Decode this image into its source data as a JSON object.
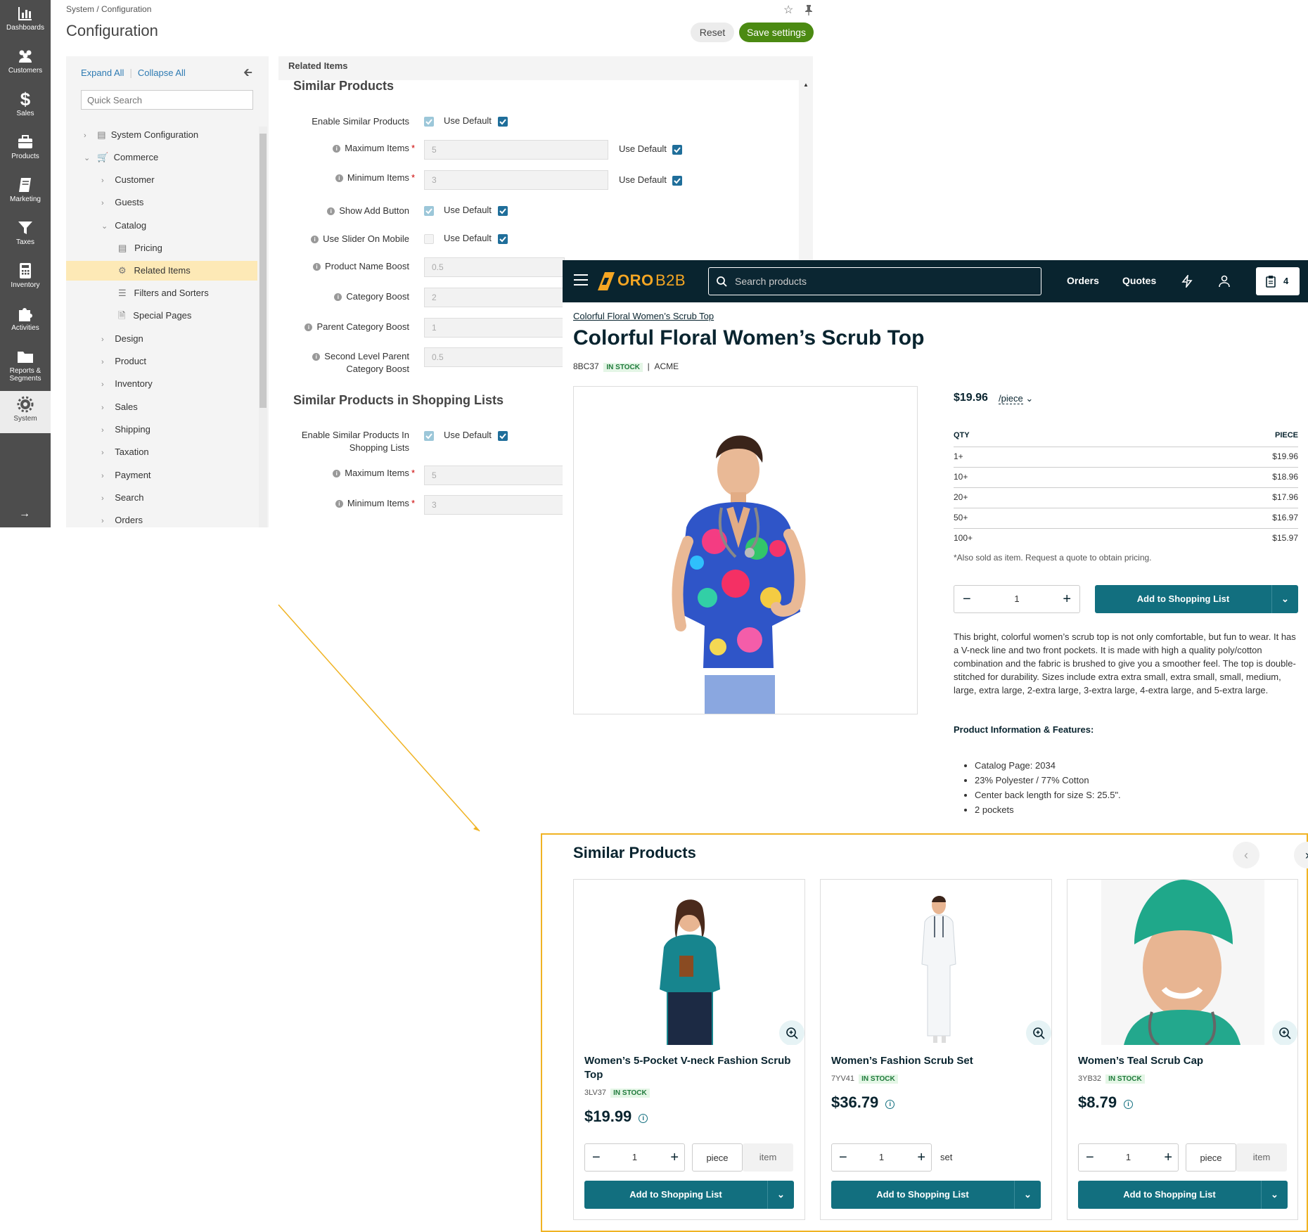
{
  "nav": [
    {
      "label": "Dashboards",
      "icon": "bar-chart-icon"
    },
    {
      "label": "Customers",
      "icon": "users-icon"
    },
    {
      "label": "Sales",
      "icon": "dollar-icon"
    },
    {
      "label": "Products",
      "icon": "briefcase-icon"
    },
    {
      "label": "Marketing",
      "icon": "book-icon"
    },
    {
      "label": "Taxes",
      "icon": "filter-icon"
    },
    {
      "label": "Inventory",
      "icon": "calculator-icon"
    },
    {
      "label": "Activities",
      "icon": "puzzle-icon"
    },
    {
      "label": "Reports & Segments",
      "icon": "folder-icon"
    },
    {
      "label": "System",
      "icon": "gear-icon"
    }
  ],
  "config": {
    "breadcrumb": "System / Configuration",
    "title": "Configuration",
    "reset": "Reset",
    "save": "Save settings",
    "expand_all": "Expand All",
    "collapse_all": "Collapse All",
    "quick_search_placeholder": "Quick Search",
    "tree": [
      "System Configuration",
      "Commerce",
      "Customer",
      "Guests",
      "Catalog",
      "Pricing",
      "Related Items",
      "Filters and Sorters",
      "Special Pages",
      "Design",
      "Product",
      "Inventory",
      "Sales",
      "Shipping",
      "Taxation",
      "Payment",
      "Search",
      "Orders"
    ],
    "section": "Related Items",
    "similar_heading": "Similar Products",
    "shopping_heading": "Similar Products in Shopping Lists",
    "use_default": "Use Default",
    "fields": [
      {
        "label": "Enable Similar Products",
        "value": ""
      },
      {
        "label": "Maximum Items",
        "value": "5"
      },
      {
        "label": "Minimum Items",
        "value": "3"
      },
      {
        "label": "Show Add Button",
        "value": ""
      },
      {
        "label": "Use Slider On Mobile",
        "value": ""
      },
      {
        "label": "Product Name Boost",
        "value": "0.5"
      },
      {
        "label": "Category Boost",
        "value": "2"
      },
      {
        "label": "Parent Category Boost",
        "value": "1"
      },
      {
        "label": "Second Level Parent",
        "label2": "Category Boost",
        "value": "0.5"
      }
    ],
    "shop_fields": [
      {
        "label": "Enable Similar Products In",
        "label2": "Shopping Lists",
        "value": ""
      },
      {
        "label": "Maximum Items",
        "value": "5"
      },
      {
        "label": "Minimum Items",
        "value": "3"
      }
    ]
  },
  "store": {
    "logo": "ORO",
    "logo2": "B2B",
    "search_placeholder": "Search products",
    "orders": "Orders",
    "quotes": "Quotes",
    "cart_count": "4",
    "breadcrumb": "Colorful Floral Women’s Scrub Top",
    "title": "Colorful Floral Women’s Scrub Top",
    "sku": "8BC37",
    "stock": "IN STOCK",
    "brand": "ACME",
    "price": "$19.96",
    "unit": "/piece",
    "qty_header": "QTY",
    "piece_header": "PIECE",
    "tiers": [
      {
        "qty": "1+",
        "price": "$19.96"
      },
      {
        "qty": "10+",
        "price": "$18.96"
      },
      {
        "qty": "20+",
        "price": "$17.96"
      },
      {
        "qty": "50+",
        "price": "$16.97"
      },
      {
        "qty": "100+",
        "price": "$15.97"
      }
    ],
    "note": "*Also sold as item. Request a quote to obtain pricing.",
    "qty": "1",
    "add_label": "Add to Shopping List",
    "description": "This bright, colorful women’s scrub top is not only comfortable, but fun to wear. It has a V-neck line and two front pockets. It is made with high a quality poly/cotton combination and the fabric is brushed to give you a smoother feel. The top is double-stitched for durability. Sizes include extra extra small, extra small, small, medium, large, extra large, 2-extra large, 3-extra large, 4-extra large, and 5-extra large.",
    "features_title": "Product Information & Features:",
    "features": [
      "Catalog Page: 2034",
      "23% Polyester / 77% Cotton",
      "Center back length for size S: 25.5\".",
      "2 pockets"
    ],
    "similar_title": "Similar Products",
    "similar": [
      {
        "name": "Women’s 5-Pocket V-neck Fashion Scrub Top",
        "sku": "3LV37",
        "stock": "IN STOCK",
        "price": "$19.99",
        "qty": "1",
        "unit1": "piece",
        "unit2": "item",
        "add": "Add to Shopping List"
      },
      {
        "name": "Women’s Fashion Scrub Set",
        "sku": "7YV41",
        "stock": "IN STOCK",
        "price": "$36.79",
        "qty": "1",
        "unit1": "set",
        "unit2": "",
        "add": "Add to Shopping List"
      },
      {
        "name": "Women’s Teal Scrub Cap",
        "sku": "3YB32",
        "stock": "IN STOCK",
        "price": "$8.79",
        "qty": "1",
        "unit1": "piece",
        "unit2": "item",
        "add": "Add to Shopping List"
      }
    ]
  },
  "colors": {
    "accent": "#126f7f",
    "header": "#09242f",
    "save": "#4b8a12",
    "highlight": "#f0b323"
  }
}
